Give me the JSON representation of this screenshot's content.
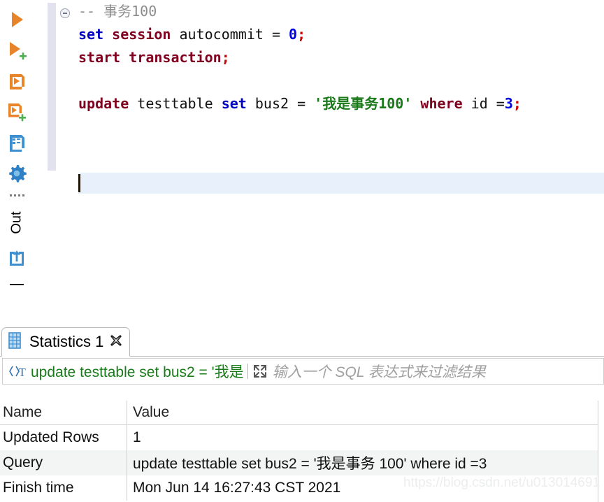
{
  "toolbar": {
    "buttons": [
      {
        "name": "execute-statement-button",
        "icon": "play-icon"
      },
      {
        "name": "execute-statement-new-tab-button",
        "icon": "play-plus-icon"
      },
      {
        "name": "execute-script-button",
        "icon": "script-execute-icon"
      },
      {
        "name": "execute-script-new-tab-button",
        "icon": "script-execute-plus-icon"
      },
      {
        "name": "explain-plan-button",
        "icon": "script-document-icon"
      },
      {
        "name": "settings-button",
        "icon": "gear-icon"
      }
    ],
    "out_label": "Out",
    "export_icon": "export-upload-icon"
  },
  "editor": {
    "lines": [
      [
        {
          "t": "-- 事务100",
          "c": "cmt"
        }
      ],
      [
        {
          "t": "set",
          "c": "kw-blue"
        },
        {
          "t": " ",
          "c": "plain"
        },
        {
          "t": "session",
          "c": "kw-red"
        },
        {
          "t": " autocommit = ",
          "c": "plain"
        },
        {
          "t": "0",
          "c": "num"
        },
        {
          "t": ";",
          "c": "semi"
        }
      ],
      [
        {
          "t": "start transaction",
          "c": "kw-red"
        },
        {
          "t": ";",
          "c": "semi"
        }
      ],
      [
        {
          "t": "",
          "c": "plain"
        }
      ],
      [
        {
          "t": "update",
          "c": "kw-red"
        },
        {
          "t": " testtable ",
          "c": "plain"
        },
        {
          "t": "set",
          "c": "kw-blue"
        },
        {
          "t": " bus2 = ",
          "c": "plain"
        },
        {
          "t": "'我是事务100'",
          "c": "str"
        },
        {
          "t": " ",
          "c": "plain"
        },
        {
          "t": "where",
          "c": "kw-red"
        },
        {
          "t": " id =",
          "c": "plain"
        },
        {
          "t": "3",
          "c": "num"
        },
        {
          "t": ";",
          "c": "semi"
        }
      ],
      [
        {
          "t": "",
          "c": "plain"
        }
      ],
      [
        {
          "t": "",
          "c": "plain"
        }
      ]
    ],
    "fold_icon": "fold-collapse-icon"
  },
  "results": {
    "tab": {
      "label": "Statistics 1",
      "grid_icon": "grid-table-icon",
      "close_icon": "close-icon"
    },
    "filter": {
      "type_icon": "sql-text-icon",
      "query_text": "update testtable set bus2 = '我是",
      "expand_icon": "expand-arrows-icon",
      "placeholder": "输入一个 SQL 表达式来过滤结果"
    },
    "grid": {
      "columns": [
        "Name",
        "Value"
      ],
      "rows": [
        {
          "name": "Updated Rows",
          "value": "1"
        },
        {
          "name": "Query",
          "value": "update testtable set bus2 = '我是事务 100' where id =3"
        },
        {
          "name": "Finish time",
          "value": "Mon Jun 14 16:27:43 CST 2021"
        }
      ]
    }
  },
  "watermark": "https://blog.csdn.net/u013014691"
}
